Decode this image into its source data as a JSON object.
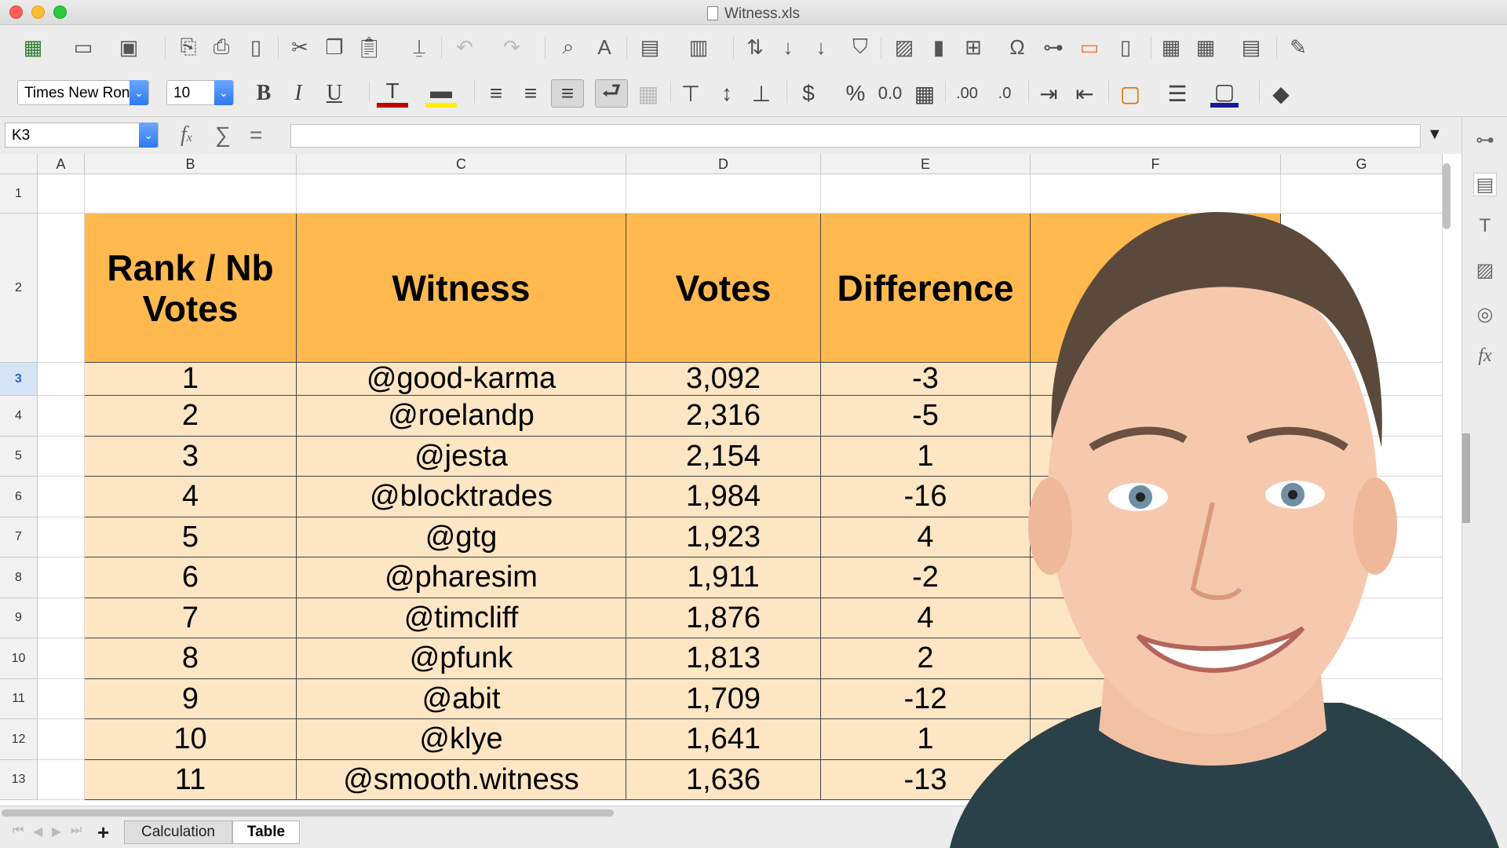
{
  "window": {
    "title": "Witness.xls"
  },
  "format_toolbar": {
    "font_name": "Times New Ron",
    "font_size": "10"
  },
  "formula_bar": {
    "cell_reference": "K3",
    "formula_value": ""
  },
  "columns": [
    "A",
    "B",
    "C",
    "D",
    "E",
    "F",
    "G"
  ],
  "rows": [
    "1",
    "2",
    "3",
    "4",
    "5",
    "6",
    "7",
    "8",
    "9",
    "10",
    "11",
    "12",
    "13"
  ],
  "selected_row": "3",
  "table": {
    "headers": [
      "Rank / Nb Votes",
      "Witness",
      "Votes",
      "Difference"
    ],
    "rows": [
      [
        "1",
        "@good-karma",
        "3,092",
        "-3"
      ],
      [
        "2",
        "@roelandp",
        "2,316",
        "-5"
      ],
      [
        "3",
        "@jesta",
        "2,154",
        "1"
      ],
      [
        "4",
        "@blocktrades",
        "1,984",
        "-16"
      ],
      [
        "5",
        "@gtg",
        "1,923",
        "4"
      ],
      [
        "6",
        "@pharesim",
        "1,911",
        "-2"
      ],
      [
        "7",
        "@timcliff",
        "1,876",
        "4"
      ],
      [
        "8",
        "@pfunk",
        "1,813",
        "2"
      ],
      [
        "9",
        "@abit",
        "1,709",
        "-12"
      ],
      [
        "10",
        "@klye",
        "1,641",
        "1"
      ],
      [
        "11",
        "@smooth.witness",
        "1,636",
        "-13"
      ]
    ]
  },
  "sheet_tabs": [
    {
      "label": "Calculation",
      "active": false
    },
    {
      "label": "Table",
      "active": true
    }
  ],
  "colors": {
    "header_fill": "#ffb94f",
    "data_fill": "#fde6c4",
    "accent": "#2d79f0"
  },
  "icons": [
    "table-icon",
    "open-icon",
    "save-icon",
    "print-icon",
    "cut-icon",
    "copy-icon",
    "paste-icon",
    "find-icon",
    "chart-icon",
    "sort-icon",
    "bold-icon",
    "italic-icon",
    "underline-icon",
    "currency-icon",
    "percent-icon"
  ]
}
